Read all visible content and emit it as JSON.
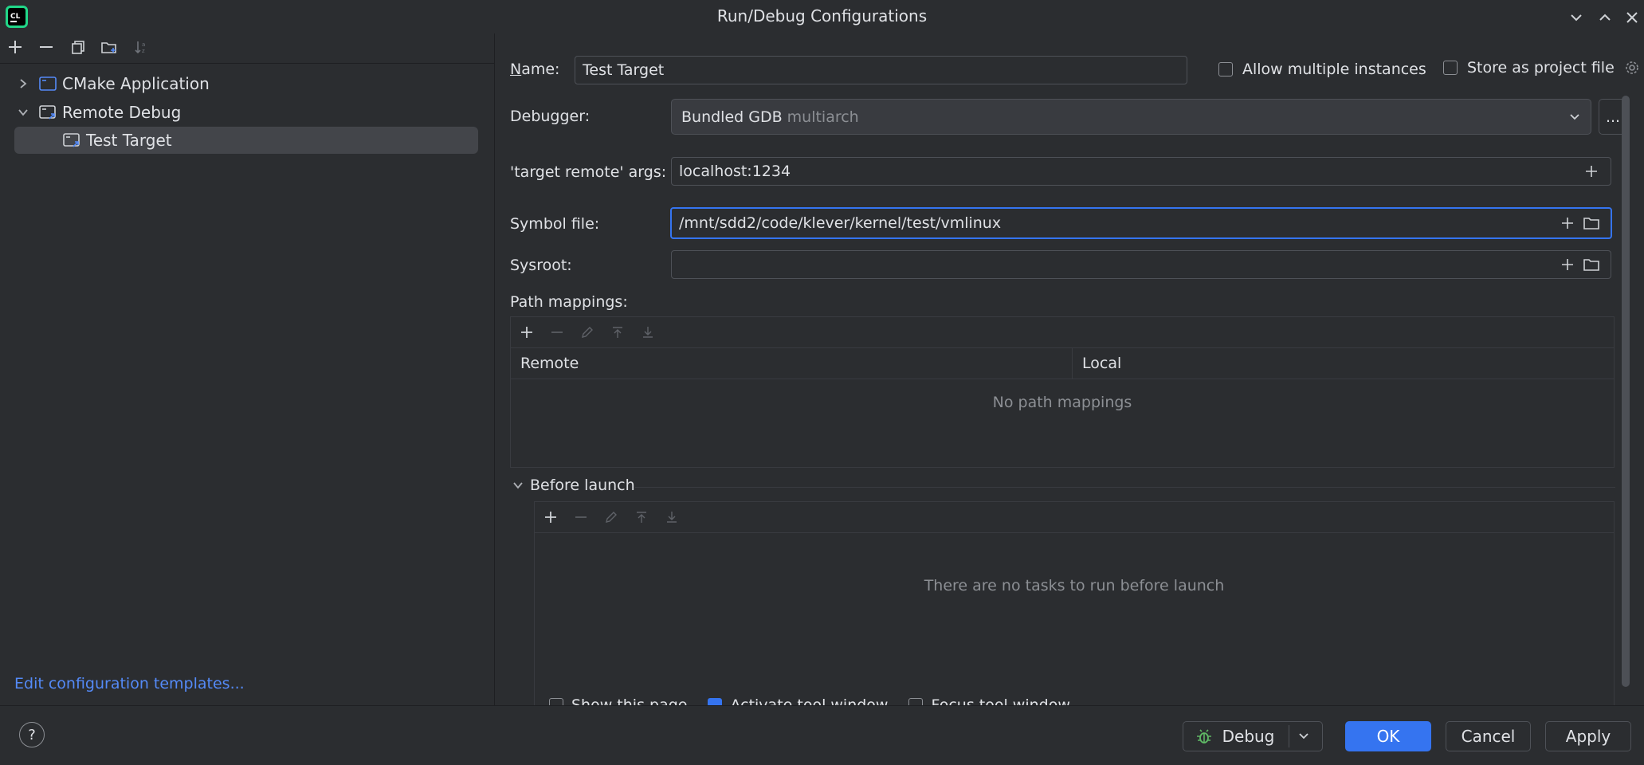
{
  "window": {
    "title": "Run/Debug Configurations"
  },
  "tree": {
    "items": [
      {
        "label": "CMake Application",
        "expanded": false
      },
      {
        "label": "Remote Debug",
        "expanded": true
      },
      {
        "label": "Test Target",
        "selected": true
      }
    ],
    "edit_templates_link": "Edit configuration templates..."
  },
  "form": {
    "name_label": "Name:",
    "name_value": "Test Target",
    "allow_multiple_label": "Allow multiple instances",
    "store_project_label": "Store as project file",
    "debugger_label": "Debugger:",
    "debugger_value": "Bundled GDB",
    "debugger_hint": "multiarch",
    "debugger_more": "...",
    "target_remote_label": "'target remote' args:",
    "target_remote_value": "localhost:1234",
    "symbol_file_label": "Symbol file:",
    "symbol_file_value": "/mnt/sdd2/code/klever/kernel/test/vmlinux",
    "sysroot_label": "Sysroot:",
    "sysroot_value": "",
    "path_mappings_label": "Path mappings:",
    "path_mappings_columns": [
      "Remote",
      "Local"
    ],
    "path_mappings_empty": "No path mappings",
    "before_launch_label": "Before launch",
    "before_launch_empty": "There are no tasks to run before launch",
    "bottom_options": [
      {
        "label": "Show this page",
        "checked": false
      },
      {
        "label": "Activate tool window",
        "checked": true
      },
      {
        "label": "Focus tool window",
        "checked": false
      }
    ]
  },
  "footer": {
    "help": "?",
    "debug_label": "Debug",
    "ok_label": "OK",
    "cancel_label": "Cancel",
    "apply_label": "Apply"
  },
  "colors": {
    "background": "#2b2d30",
    "accent": "#3574f0",
    "link": "#548af7"
  }
}
